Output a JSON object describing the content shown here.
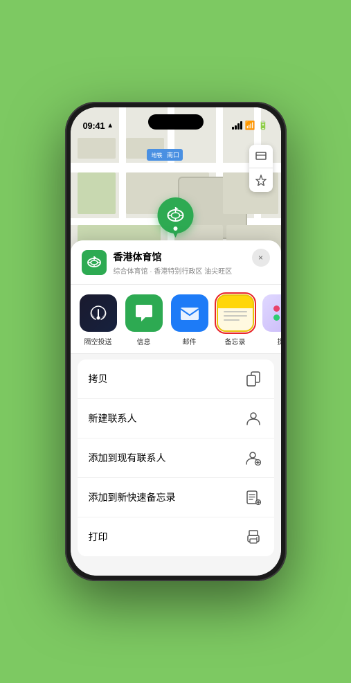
{
  "statusBar": {
    "time": "09:41",
    "location_arrow": "▲"
  },
  "mapLabel": "南口",
  "mapControls": {
    "map_icon": "⊞",
    "location_icon": "➤"
  },
  "pin": {
    "label": "香港体育馆"
  },
  "locationHeader": {
    "name": "香港体育馆",
    "description": "综合体育馆 · 香港特别行政区 油尖旺区",
    "closeLabel": "×"
  },
  "shareApps": [
    {
      "id": "airdrop",
      "label": "隔空投送"
    },
    {
      "id": "messages",
      "label": "信息"
    },
    {
      "id": "mail",
      "label": "邮件"
    },
    {
      "id": "notes",
      "label": "备忘录",
      "selected": true
    },
    {
      "id": "more",
      "label": "提"
    }
  ],
  "menuItems": [
    {
      "id": "copy",
      "label": "拷贝",
      "icon": "copy"
    },
    {
      "id": "new-contact",
      "label": "新建联系人",
      "icon": "person"
    },
    {
      "id": "add-existing",
      "label": "添加到现有联系人",
      "icon": "person-add"
    },
    {
      "id": "add-notes",
      "label": "添加到新快速备忘录",
      "icon": "notes-add"
    },
    {
      "id": "print",
      "label": "打印",
      "icon": "print"
    }
  ]
}
